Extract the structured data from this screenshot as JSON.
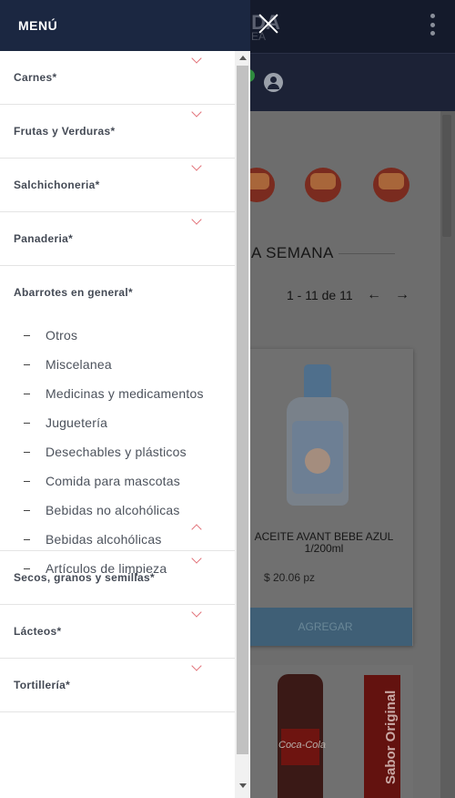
{
  "background": {
    "logo": "IDA",
    "logo_sub": "EA",
    "week_title": "LA SEMANA",
    "pager": "1 - 11 de 11",
    "product": {
      "name": "ACEITE AVANT BEBE AZUL 1/200ml",
      "price": "$ 20.06 pz",
      "add_button": "AGREGAR"
    },
    "coke_label": "Coca-Cola",
    "promo_label": "Sabor Original"
  },
  "menu": {
    "title": "MENÚ",
    "items": [
      {
        "label": "Carnes*"
      },
      {
        "label": "Frutas y Verduras*"
      },
      {
        "label": "Salchichoneria*"
      },
      {
        "label": "Panaderia*"
      },
      {
        "label": "Abarrotes en general*",
        "expanded": true,
        "subitems": [
          {
            "label": "Otros"
          },
          {
            "label": "Miscelanea"
          },
          {
            "label": "Medicinas y medicamentos"
          },
          {
            "label": "Juguetería"
          },
          {
            "label": "Desechables y plásticos"
          },
          {
            "label": "Comida para mascotas"
          },
          {
            "label": "Bebidas no alcohólicas"
          },
          {
            "label": "Bebidas alcohólicas"
          },
          {
            "label": "Artículos de limpieza"
          }
        ]
      },
      {
        "label": "Secos, granos y semillas*"
      },
      {
        "label": "Lácteos*"
      },
      {
        "label": "Tortillería*"
      }
    ]
  }
}
